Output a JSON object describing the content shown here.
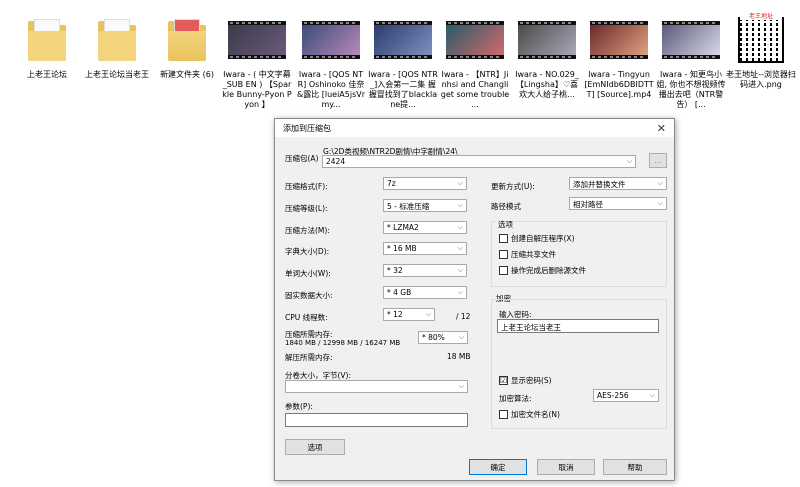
{
  "desktop": {
    "files": [
      {
        "name": "上老王论坛",
        "kind": "folder"
      },
      {
        "name": "上老王论坛当老王",
        "kind": "folder"
      },
      {
        "name": "新建文件夹 (6)",
        "kind": "folder-qr"
      },
      {
        "name": "Iwara - ( 中文字幕_SUB EN ) 【Sparkle Bunny-Pyon Pyon 】",
        "kind": "video"
      },
      {
        "name": "Iwara - [QOS NTR] Oshinoko 佳奈&露比 [lueiA5jsVrmy...",
        "kind": "video"
      },
      {
        "name": "Iwara - [QOS NTR_]入会第一二集 握握冒找到了blacklane提...",
        "kind": "video"
      },
      {
        "name": "Iwara - 【NTR】Jinhsi and Changli get some trouble ...",
        "kind": "video"
      },
      {
        "name": "Iwara - NO.029_【Lingsha】♡喜欢大人给子桃...",
        "kind": "video"
      },
      {
        "name": "Iwara - Tingyun [EmNIdb6DBIDTTT] [Source].mp4",
        "kind": "video"
      },
      {
        "name": "Iwara - 知更鸟小姐, 你也不想视频传播出去吧（NTR警告） [...",
        "kind": "video"
      },
      {
        "name": "老王地址--浏览器扫码进入.png",
        "kind": "qr",
        "caption": "老王地址"
      }
    ]
  },
  "dialog": {
    "title": "添加到压缩包",
    "close_glyph": "✕",
    "archive_label": "压缩包(A)",
    "archive_path": "G:\\2D类视频\\NTR2D剧情\\中字剧情\\24\\",
    "archive_name": "2424",
    "browse_label": "...",
    "format_label": "压缩格式(F):",
    "format_value": "7z",
    "level_label": "压缩等级(L):",
    "level_value": "5 - 标准压缩",
    "method_label": "压缩方法(M):",
    "method_value": "* LZMA2",
    "dict_label": "字典大小(D):",
    "dict_value": "* 16 MB",
    "word_label": "单词大小(W):",
    "word_value": "* 32",
    "solid_label": "固实数据大小:",
    "solid_value": "* 4 GB",
    "cpu_label": "CPU 线程数:",
    "cpu_value": "* 12",
    "cpu_max": "/ 12",
    "mem_label": "压缩所需内存:",
    "mem_detail": "1840 MB / 12998 MB / 16247 MB",
    "mem_percent": "* 80%",
    "decomp_label": "解压所需内存:",
    "decomp_value": "18 MB",
    "split_label": "分卷大小，字节(V):",
    "split_value": "",
    "params_label": "参数(P):",
    "params_value": "",
    "options_button": "选项",
    "update_label": "更新方式(U):",
    "update_value": "添加并替换文件",
    "path_label": "路径模式",
    "path_value": "相对路径",
    "options_group": "选项",
    "opt_sfx": "创建自解压程序(X)",
    "opt_shared": "压缩共享文件",
    "opt_delete": "操作完成后删除源文件",
    "encrypt_group": "加密",
    "password_label": "输入密码:",
    "password_value": "上老王论坛当老王",
    "show_password": "显示密码(S)",
    "show_password_check": "☑",
    "enc_method_label": "加密算法:",
    "enc_method_value": "AES-256",
    "enc_names": "加密文件名(N)",
    "ok_button": "确定",
    "cancel_button": "取消",
    "help_button": "帮助"
  }
}
